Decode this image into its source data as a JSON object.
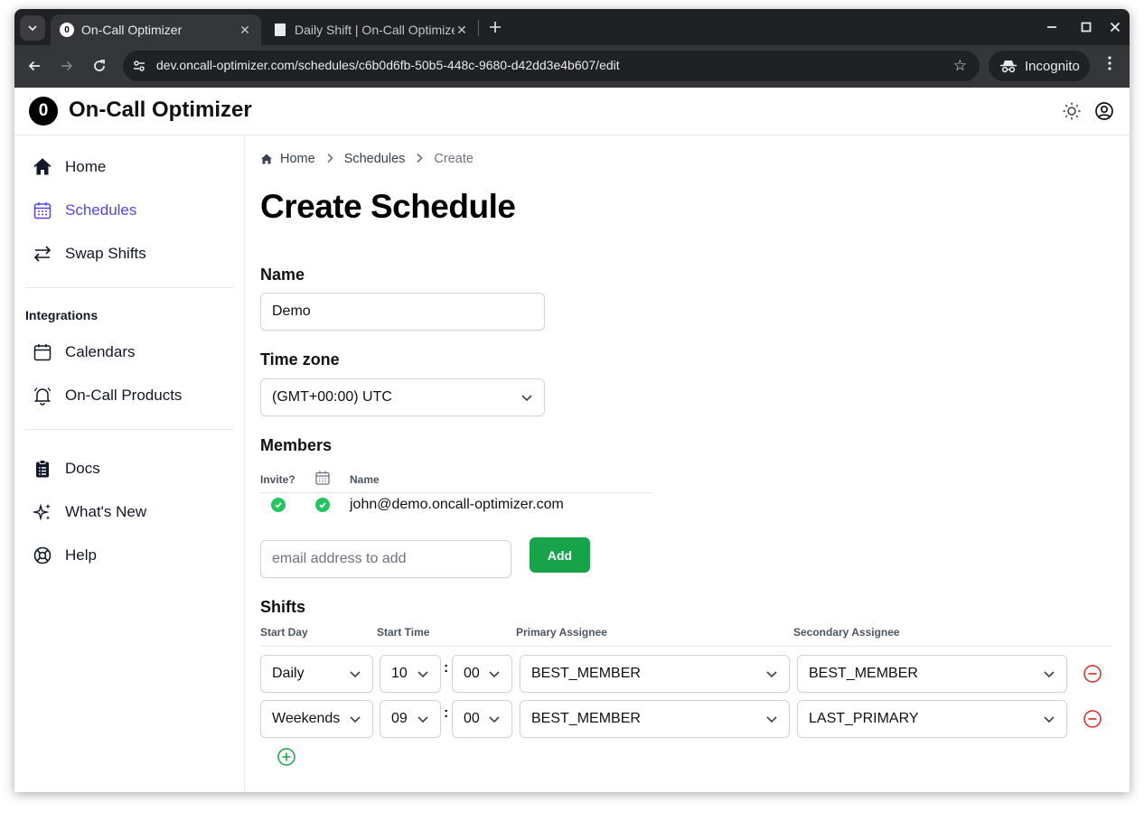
{
  "browser": {
    "tabs": [
      {
        "title": "On-Call Optimizer",
        "favicon": "0"
      },
      {
        "title": "Daily Shift | On-Call Optimizer"
      }
    ],
    "url": "dev.oncall-optimizer.com/schedules/c6b0d6fb-50b5-448c-9680-d42dd3e4b607/edit",
    "profile_label": "Incognito"
  },
  "app": {
    "logo_glyph": "0",
    "title": "On-Call Optimizer"
  },
  "sidebar": {
    "items": [
      {
        "label": "Home",
        "icon": "home-icon"
      },
      {
        "label": "Schedules",
        "icon": "calendar-icon",
        "active": true
      },
      {
        "label": "Swap Shifts",
        "icon": "swap-arrows-icon"
      }
    ],
    "integrations_heading": "Integrations",
    "integrations": [
      {
        "label": "Calendars",
        "icon": "calendar-icon"
      },
      {
        "label": "On-Call Products",
        "icon": "bell-icon"
      }
    ],
    "resources": [
      {
        "label": "Docs",
        "icon": "clipboard-icon"
      },
      {
        "label": "What's New",
        "icon": "sparkles-icon"
      },
      {
        "label": "Help",
        "icon": "lifebuoy-icon"
      }
    ]
  },
  "breadcrumb": {
    "home": "Home",
    "schedules": "Schedules",
    "current": "Create"
  },
  "page": {
    "title": "Create Schedule"
  },
  "form": {
    "name_label": "Name",
    "name_value": "Demo",
    "timezone_label": "Time zone",
    "timezone_value": "(GMT+00:00) UTC",
    "members_label": "Members",
    "members_columns": {
      "invite": "Invite?",
      "name": "Name"
    },
    "members": [
      {
        "email": "john@demo.oncall-optimizer.com",
        "invite": true,
        "calendar": true
      }
    ],
    "email_placeholder": "email address to add",
    "add_label": "Add",
    "shifts_label": "Shifts",
    "shift_columns": {
      "start_day": "Start Day",
      "start_time": "Start Time",
      "primary": "Primary Assignee",
      "secondary": "Secondary Assignee"
    },
    "shifts": [
      {
        "start_day": "Daily",
        "hour": "10",
        "minute": "00",
        "primary": "BEST_MEMBER",
        "secondary": "BEST_MEMBER"
      },
      {
        "start_day": "Weekends",
        "hour": "09",
        "minute": "00",
        "primary": "BEST_MEMBER",
        "secondary": "LAST_PRIMARY"
      }
    ],
    "time_separator": ":"
  },
  "colors": {
    "accent": "#4f46e5",
    "success": "#16a34a",
    "danger": "#dc2626"
  }
}
